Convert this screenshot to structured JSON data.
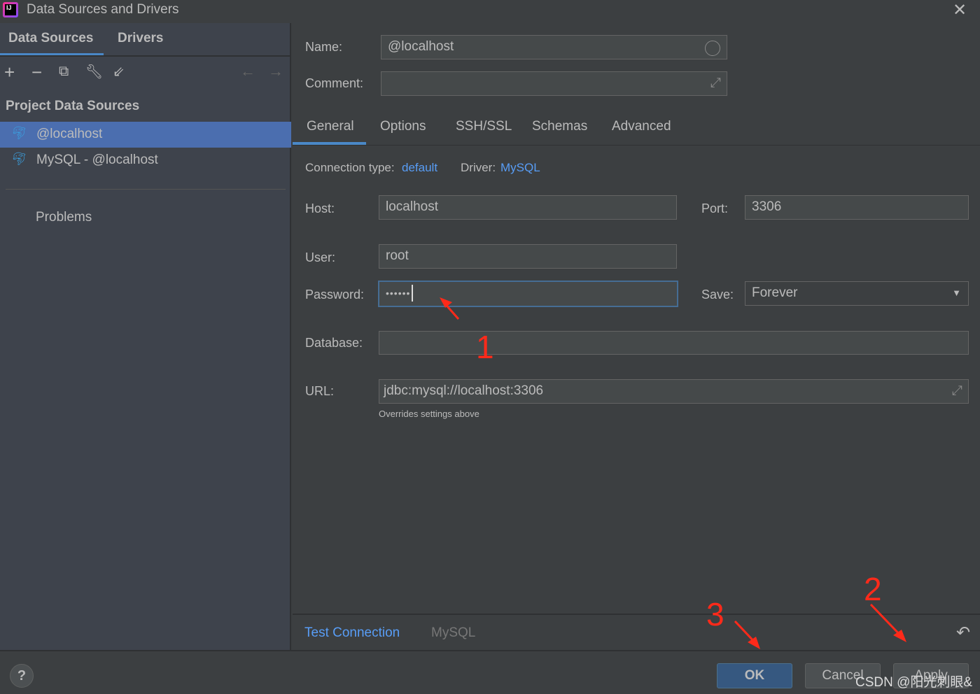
{
  "window": {
    "title": "Data Sources and Drivers"
  },
  "left": {
    "tabs": [
      {
        "label": "Data Sources"
      },
      {
        "label": "Drivers"
      }
    ],
    "section": "Project Data Sources",
    "items": [
      {
        "label": "@localhost",
        "selected": true
      },
      {
        "label": "MySQL - @localhost"
      }
    ],
    "problems": "Problems"
  },
  "form": {
    "name_label": "Name:",
    "name": "@localhost",
    "comment_label": "Comment:",
    "comment": "",
    "tabs": [
      {
        "label": "General"
      },
      {
        "label": "Options"
      },
      {
        "label": "SSH/SSL"
      },
      {
        "label": "Schemas"
      },
      {
        "label": "Advanced"
      }
    ],
    "connection_type_label": "Connection type:",
    "connection_type": "default",
    "driver_label": "Driver:",
    "driver": "MySQL",
    "host_label": "Host:",
    "host": "localhost",
    "port_label": "Port:",
    "port": "3306",
    "user_label": "User:",
    "user": "root",
    "password_label": "Password:",
    "password": "••••••",
    "save_label": "Save:",
    "save": "Forever",
    "database_label": "Database:",
    "database": "",
    "url_label": "URL:",
    "url": "jdbc:mysql://localhost:3306",
    "url_hint": "Overrides settings above"
  },
  "footer": {
    "test_connection": "Test Connection",
    "driver": "MySQL",
    "ok": "OK",
    "cancel": "Cancel",
    "apply": "Apply",
    "help": "?"
  },
  "annotations": [
    "1",
    "2",
    "3"
  ],
  "watermark": "CSDN @阳光刺眼&",
  "colors": {
    "accent": "#4a88c7",
    "selection": "#4b6eaf",
    "link": "#589df6",
    "annotation": "#ff2a1a"
  }
}
